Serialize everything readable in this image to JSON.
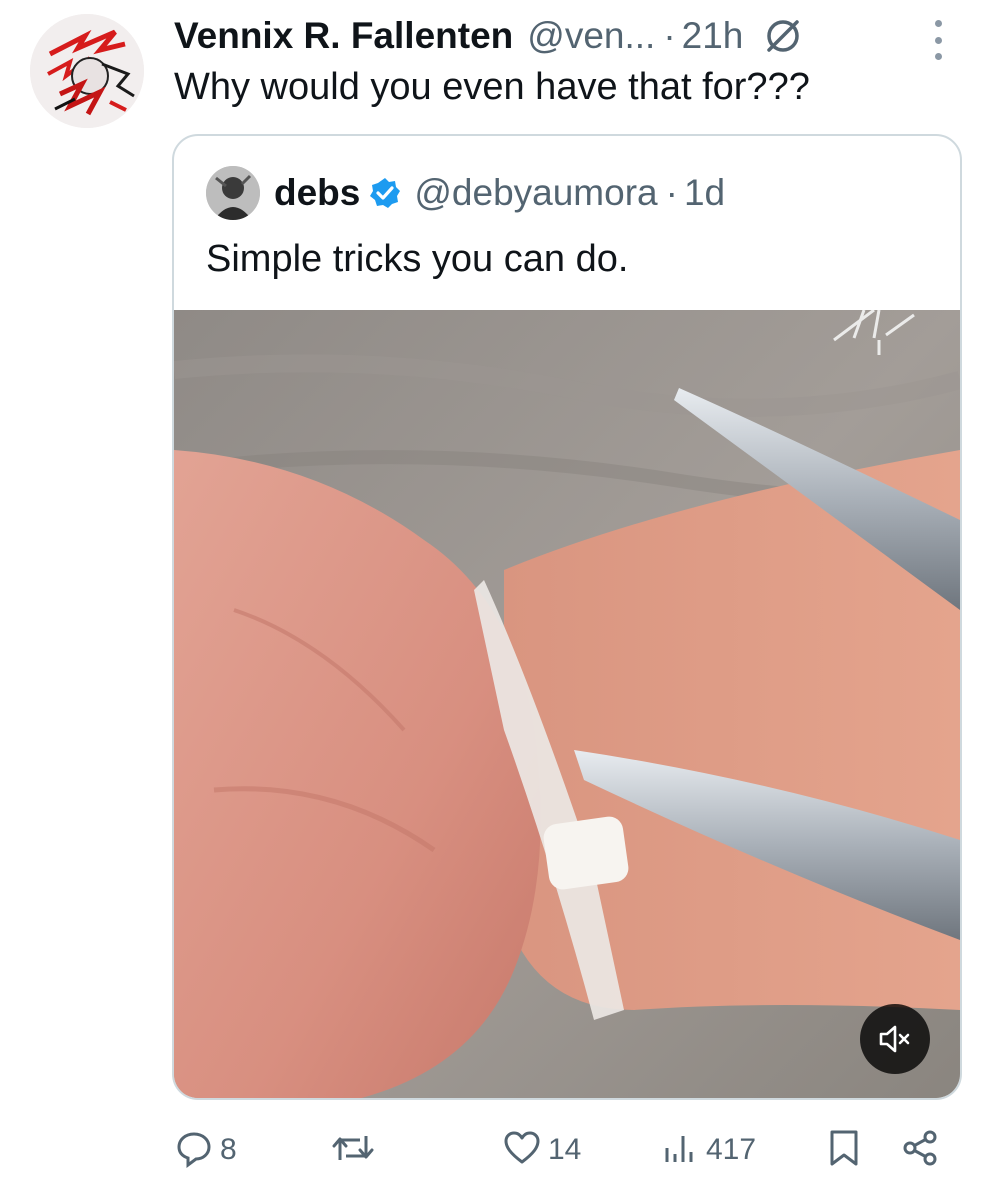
{
  "tweet": {
    "author_name": "Vennix R. Fallenten",
    "author_handle": "@ven...",
    "separator": "·",
    "time": "21h",
    "text": "Why would you even have that for???",
    "avatar_icon": "avatar-red-sketch",
    "grok_icon": "grok-icon",
    "more_icon": "more-vertical-icon"
  },
  "quote": {
    "author_name": "debs",
    "author_handle": "@debyaumora",
    "separator": "·",
    "time": "1d",
    "verified_icon": "verified-badge-icon",
    "text": "Simple tricks you can do.",
    "media": {
      "type": "video",
      "mute_icon": "volume-muted-icon"
    }
  },
  "actions": {
    "replies": "8",
    "reposts": "",
    "likes": "14",
    "views": "417",
    "icons": [
      "reply-icon",
      "repost-icon",
      "like-icon",
      "views-icon",
      "bookmark-icon",
      "share-icon"
    ]
  },
  "colors": {
    "text": "#0f1419",
    "secondary": "#536471",
    "border": "#cfd9de",
    "verified": "#1d9bf0"
  }
}
